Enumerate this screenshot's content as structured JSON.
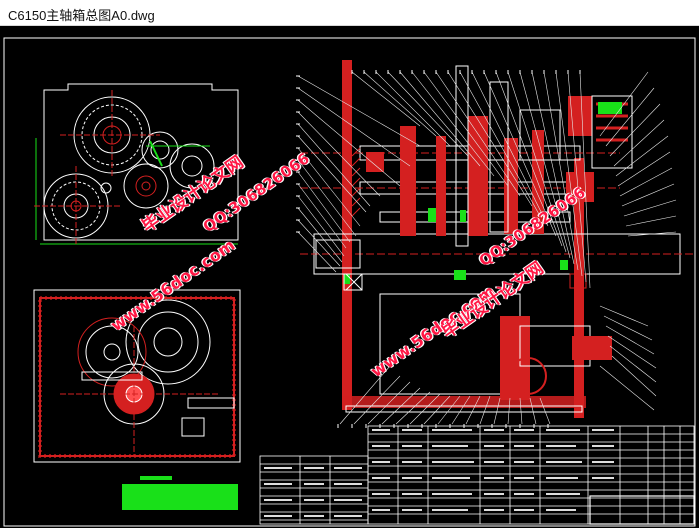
{
  "window": {
    "title": "C6150主轴箱总图A0.dwg"
  },
  "watermarks": [
    {
      "text": "毕业设计论文网"
    },
    {
      "text": "QQ:306826066"
    },
    {
      "text": "www.56doc.com"
    },
    {
      "text": "QQ:306826066"
    },
    {
      "text": "www.56doc.com"
    },
    {
      "text": "毕业设计论文网"
    }
  ],
  "colors": {
    "background": "#000000",
    "frame": "#ffffff",
    "section_red": "#d42020",
    "gear_green": "#19e019",
    "leader_white": "#e8e8e8",
    "watermark": "#ff1744"
  }
}
